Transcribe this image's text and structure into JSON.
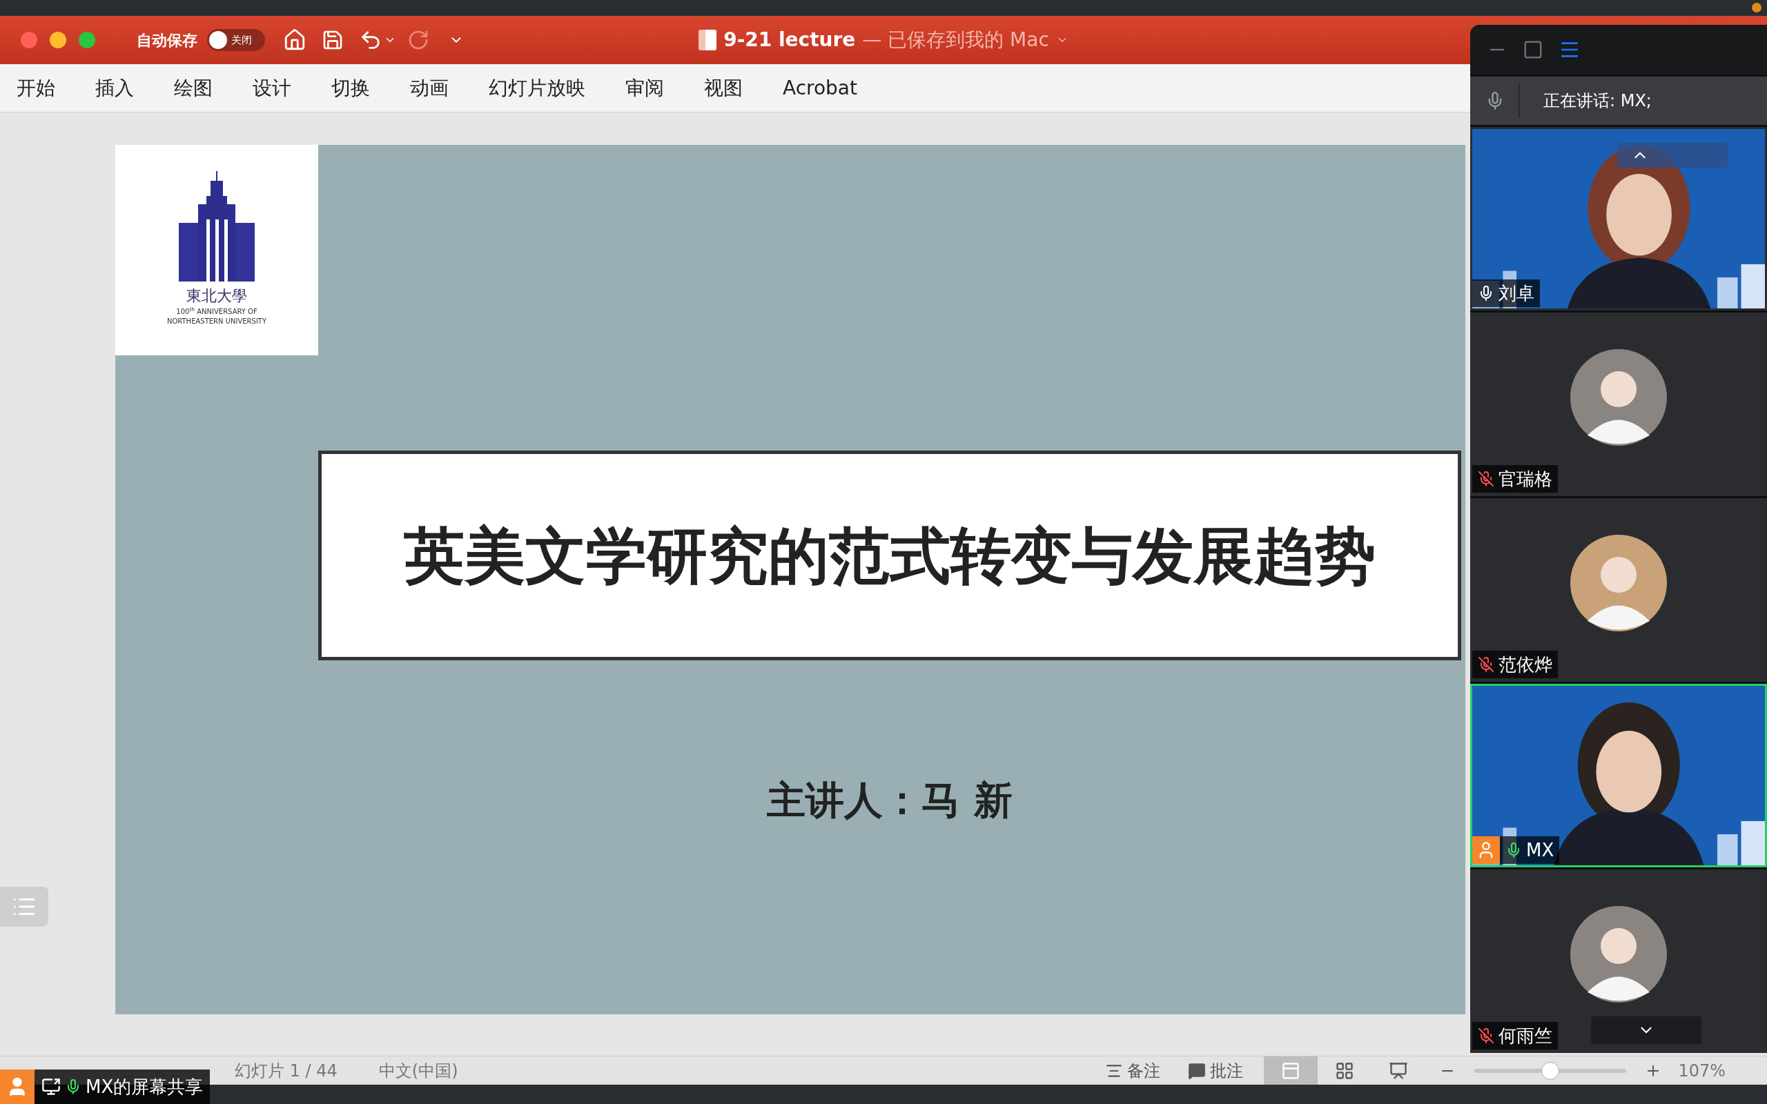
{
  "window": {
    "autosave_label": "自动保存",
    "autosave": {
      "on": false,
      "label": "关闭"
    },
    "title": "9-21 lecture",
    "subtitle": "— 已保存到我的 Mac"
  },
  "ribbon_tabs": [
    "开始",
    "插入",
    "绘图",
    "设计",
    "切换",
    "动画",
    "幻灯片放映",
    "审阅",
    "视图",
    "Acrobat"
  ],
  "slide": {
    "logo_text": "東北大學",
    "logo_caption": [
      "100$^{th}$ ANNIVERSARY OF",
      "NORTHEASTERN UNIVERSITY"
    ],
    "title": "英美文学研究的范式转变与发展趋势",
    "presenter": "主讲人：马 新"
  },
  "status_bar": {
    "slide_counter": "幻灯片 1 / 44",
    "language": "中文(中国)",
    "notes": "备注",
    "comments": "批注",
    "views": [
      {
        "kind": "normal",
        "selected": true
      },
      {
        "kind": "sorter",
        "selected": false
      },
      {
        "kind": "presenter",
        "selected": false
      }
    ],
    "zoom_level": {
      "level": 0.5
    },
    "zoom": "107%"
  },
  "meeting": {
    "speaking": "正在讲话: MX;",
    "participants": [
      {
        "name": "刘卓",
        "kind": "video",
        "muted": false,
        "active": false
      },
      {
        "name": "官瑞格",
        "muted": true,
        "active": false
      },
      {
        "name": "范依烨",
        "muted": true,
        "active": false
      },
      {
        "name": "MX",
        "kind": "video",
        "muted": false,
        "active": true
      },
      {
        "name": "何雨竺",
        "muted": true,
        "active": false
      }
    ]
  },
  "share_badge": {
    "label": "MX的屏幕共享"
  }
}
